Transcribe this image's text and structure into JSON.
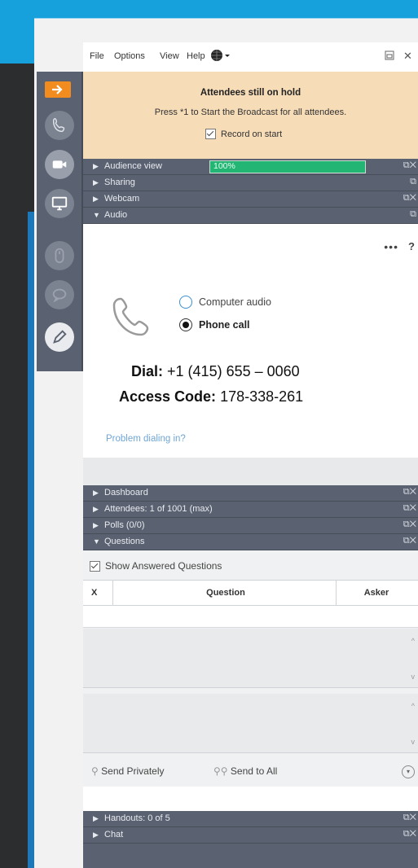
{
  "menu": {
    "file": "File",
    "options": "Options",
    "view": "View",
    "help": "Help"
  },
  "notice": {
    "title": "Attendees still on hold",
    "body": "Press *1 to Start the Broadcast for all attendees.",
    "record_label": "Record on start"
  },
  "sections": {
    "audience_view": "Audience view",
    "audience_progress": "100%",
    "audience_progress_value": 1.0,
    "sharing": "Sharing",
    "webcam": "Webcam",
    "audio": "Audio",
    "dashboard": "Dashboard",
    "attendees": "Attendees: 1 of 1001 (max)",
    "polls": "Polls (0/0)",
    "questions": "Questions",
    "handouts": "Handouts: 0 of 5",
    "chat": "Chat"
  },
  "audio": {
    "more": "•••",
    "help": "?",
    "computer_audio": "Computer audio",
    "phone_call": "Phone call",
    "selected": "phone_call",
    "dial_label": "Dial:",
    "dial_number": "+1 (415) 655 – 0060",
    "access_label": "Access Code:",
    "access_code": "178-338-261",
    "problem_link": "Problem dialing in?"
  },
  "questions": {
    "show_answered": "Show Answered Questions",
    "col_x": "X",
    "col_question": "Question",
    "col_asker": "Asker",
    "send_privately": "Send Privately",
    "send_to_all": "Send to All"
  },
  "colors": {
    "toolbar_bg": "#5a6170",
    "section_bar": "#5a6170",
    "notice_bg": "#f7dcb8",
    "accent_orange": "#f28c1e",
    "progress_green": "#22b573",
    "top_blue": "#17a1dc"
  },
  "toolbar_icons": [
    "arrow-right-icon",
    "phone-icon",
    "webcam-icon",
    "screen-share-icon",
    "mouse-icon",
    "chat-bubble-icon",
    "pen-icon"
  ]
}
